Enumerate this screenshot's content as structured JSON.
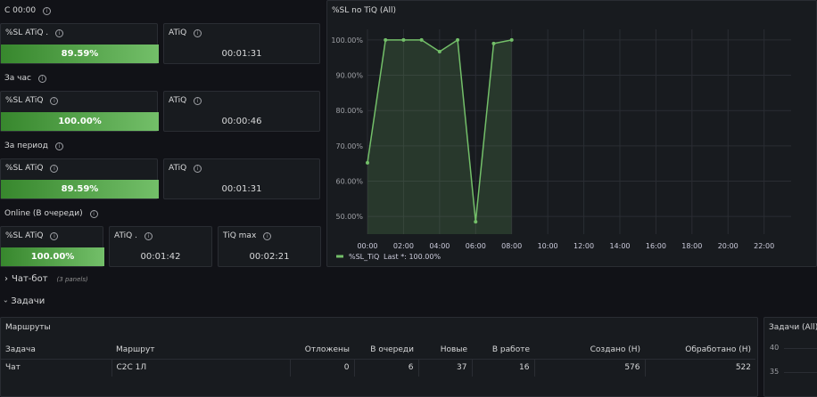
{
  "sections": {
    "today": "С 00:00",
    "hour": "За час",
    "period": "За период",
    "online": "Online (В очереди)"
  },
  "today": {
    "sl": {
      "title": "%SL ATiQ .",
      "value": "89.59%",
      "fill": 1.0
    },
    "atiq": {
      "title": "ATiQ",
      "value": "00:01:31"
    }
  },
  "hour": {
    "sl": {
      "title": "%SL ATiQ",
      "value": "100.00%",
      "fill": 1.0
    },
    "atiq": {
      "title": "ATiQ",
      "value": "00:00:46"
    }
  },
  "period": {
    "sl": {
      "title": "%SL ATiQ",
      "value": "89.59%",
      "fill": 1.0
    },
    "atiq": {
      "title": "ATiQ",
      "value": "00:01:31"
    }
  },
  "online": {
    "sl": {
      "title": "%SL ATiQ",
      "value": "100.00%",
      "fill": 1.0
    },
    "atiq": {
      "title": "ATiQ .",
      "value": "00:01:42"
    },
    "tiqmax": {
      "title": "TiQ max",
      "value": "00:02:21"
    }
  },
  "chart_panel": {
    "title": "%SL no TiQ (All)"
  },
  "chart_data": {
    "type": "area",
    "title": "%SL no TiQ (All)",
    "x": [
      "00:00",
      "01:00",
      "02:00",
      "03:00",
      "04:00",
      "05:00",
      "06:00",
      "07:00",
      "08:00"
    ],
    "series": [
      {
        "name": "%SL_TiQ",
        "values": [
          65.2,
          100,
          100,
          100,
          96.7,
          100,
          48.5,
          99,
          100
        ],
        "color": "#73bf69"
      }
    ],
    "x_ticks": [
      "00:00",
      "02:00",
      "04:00",
      "06:00",
      "08:00",
      "10:00",
      "12:00",
      "14:00",
      "16:00",
      "18:00",
      "20:00",
      "22:00"
    ],
    "y_ticks": [
      "50.00%",
      "60.00%",
      "70.00%",
      "80.00%",
      "90.00%",
      "100.00%"
    ],
    "ylim": [
      45,
      103
    ],
    "xlim": [
      0,
      23.5
    ],
    "grid": true,
    "legend": {
      "label": "%SL_TiQ",
      "stat": "Last *: 100.00%",
      "placement": "bottom-left"
    }
  },
  "rows": {
    "chatbot": {
      "label": "Чат-бот",
      "sub": "(3 panels)",
      "chevron": "›"
    },
    "tasks": {
      "label": "Задачи",
      "chevron": "›"
    }
  },
  "routes": {
    "title": "Маршруты",
    "columns": [
      "Задача",
      "Маршрут",
      "Отложены",
      "В очереди",
      "Новые",
      "В работе",
      "Создано (Н)",
      "Обработано (Н)"
    ],
    "rows": [
      [
        "Чат",
        "C2C 1Л",
        "0",
        "6",
        "37",
        "16",
        "576",
        "522"
      ]
    ]
  },
  "tasks_panel": {
    "title": "Задачи (All)",
    "y_ticks": [
      "40",
      "35"
    ]
  },
  "colors": {
    "accent": "#73bf69",
    "bar_dark": "#37872d",
    "bg": "#111217",
    "panel": "#181b1f"
  }
}
